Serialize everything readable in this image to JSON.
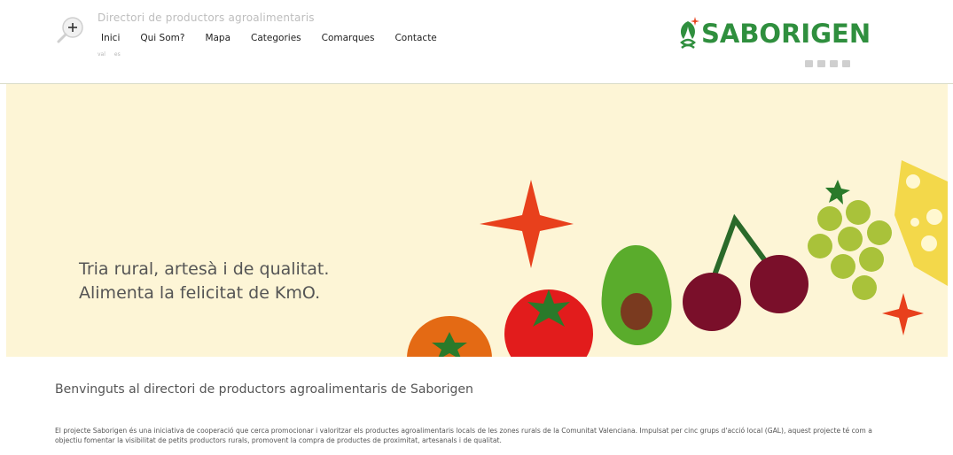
{
  "header": {
    "site_title": "Directori de productors agroalimentaris",
    "nav": [
      "Inici",
      "Qui Som?",
      "Mapa",
      "Categories",
      "Comarques",
      "Contacte"
    ],
    "languages": [
      "val",
      "es"
    ],
    "logo_text": "SABORIGEN",
    "social_icons": [
      "facebook-icon",
      "twitter-icon",
      "instagram-icon",
      "youtube-icon"
    ]
  },
  "hero": {
    "line1": "Tria rural, artesà i de qualitat.",
    "line2": "Alimenta la felicitat de KmO."
  },
  "content": {
    "welcome": "Benvinguts al directori de productors agroalimentaris de Saborigen",
    "intro": "El projecte Saborigen és una iniciativa de cooperació que cerca promocionar i valoritzar els productes agroalimentaris locals de les zones rurals de la Comunitat Valenciana. Impulsat per cinc grups d'acció local (GAL), aquest projecte té com a objectiu fomentar la visibilitat de petits productors rurals, promovent la compra de productes de proximitat, artesanals i de qualitat."
  },
  "colors": {
    "hero_bg": "#fdf5d6",
    "brand_green": "#2f8f3e",
    "star_red": "#e8401c",
    "tomato_red": "#e21c1c",
    "orange": "#e46a14",
    "avocado_green": "#5aac2c",
    "cherry": "#7a0f2a",
    "grape": "#a9c23a",
    "cheese": "#f3d84a"
  }
}
